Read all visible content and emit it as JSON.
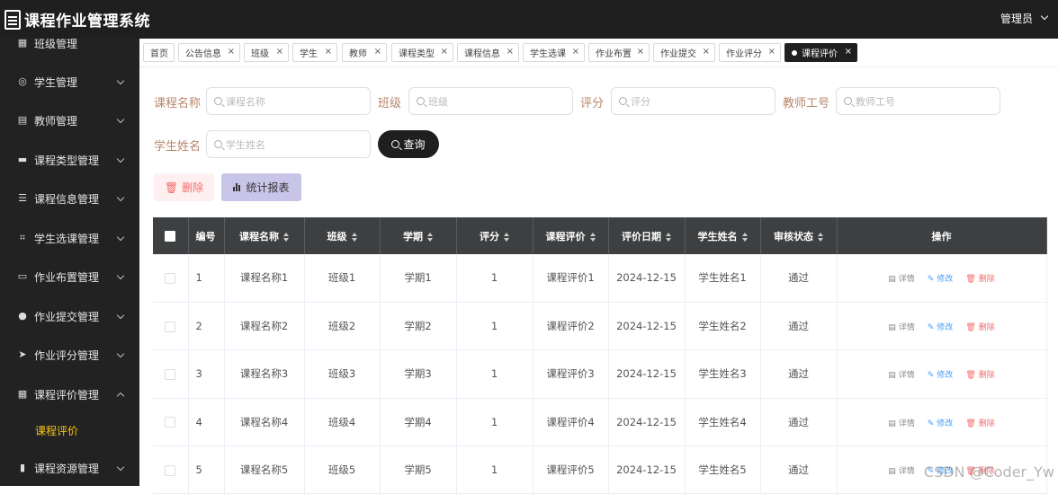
{
  "app": {
    "title": "课程作业管理系统",
    "user": "管理员"
  },
  "sidebar": {
    "items": [
      {
        "label": "班级管理",
        "icon": "grid-icon",
        "sym": "▦"
      },
      {
        "label": "学生管理",
        "icon": "target-icon",
        "sym": "◎"
      },
      {
        "label": "教师管理",
        "icon": "clipboard-icon",
        "sym": "▤"
      },
      {
        "label": "课程类型管理",
        "icon": "briefcase-icon",
        "sym": "▬"
      },
      {
        "label": "课程信息管理",
        "icon": "list-icon",
        "sym": "☰"
      },
      {
        "label": "学生选课管理",
        "icon": "crop-icon",
        "sym": "⌗"
      },
      {
        "label": "作业布置管理",
        "icon": "chat-icon",
        "sym": "▭"
      },
      {
        "label": "作业提交管理",
        "icon": "user-icon",
        "sym": "●"
      },
      {
        "label": "作业评分管理",
        "icon": "send-icon",
        "sym": "➤"
      },
      {
        "label": "课程评价管理",
        "icon": "grid-icon",
        "sym": "▦"
      },
      {
        "label": "课程资源管理",
        "icon": "bar-chart-icon",
        "sym": "▮"
      }
    ],
    "sub_active": "课程评价"
  },
  "tabs": [
    {
      "label": "首页"
    },
    {
      "label": "公告信息"
    },
    {
      "label": "班级"
    },
    {
      "label": "学生"
    },
    {
      "label": "教师"
    },
    {
      "label": "课程类型"
    },
    {
      "label": "课程信息"
    },
    {
      "label": "学生选课"
    },
    {
      "label": "作业布置"
    },
    {
      "label": "作业提交"
    },
    {
      "label": "作业评分"
    },
    {
      "label": "课程评价"
    }
  ],
  "filters": {
    "course_name": {
      "label": "课程名称",
      "placeholder": "课程名称"
    },
    "class": {
      "label": "班级",
      "placeholder": "班级"
    },
    "score": {
      "label": "评分",
      "placeholder": "评分"
    },
    "teacher_no": {
      "label": "教师工号",
      "placeholder": "教师工号"
    },
    "student_name": {
      "label": "学生姓名",
      "placeholder": "学生姓名"
    },
    "query_label": "查询"
  },
  "actions": {
    "delete_label": "删除",
    "stats_label": "统计报表"
  },
  "table": {
    "headers": [
      "编号",
      "课程名称",
      "班级",
      "学期",
      "评分",
      "课程评价",
      "评价日期",
      "学生姓名",
      "审核状态",
      "操作"
    ],
    "rows": [
      [
        "1",
        "课程名称1",
        "班级1",
        "学期1",
        "1",
        "课程评价1",
        "2024-12-15",
        "学生姓名1",
        "通过"
      ],
      [
        "2",
        "课程名称2",
        "班级2",
        "学期2",
        "1",
        "课程评价2",
        "2024-12-15",
        "学生姓名2",
        "通过"
      ],
      [
        "3",
        "课程名称3",
        "班级3",
        "学期3",
        "1",
        "课程评价3",
        "2024-12-15",
        "学生姓名3",
        "通过"
      ],
      [
        "4",
        "课程名称4",
        "班级4",
        "学期4",
        "1",
        "课程评价4",
        "2024-12-15",
        "学生姓名4",
        "通过"
      ],
      [
        "5",
        "课程名称5",
        "班级5",
        "学期5",
        "1",
        "课程评价5",
        "2024-12-15",
        "学生姓名5",
        "通过"
      ]
    ],
    "ops": {
      "detail": "详情",
      "edit": "修改",
      "delete": "删除"
    }
  },
  "watermark": "CSDN @Coder_Yw",
  "colors": {
    "accent": "#1f1f1f",
    "sidebar_bg": "#222222",
    "active_sub": "#f5c518",
    "label": "#b8866b"
  }
}
